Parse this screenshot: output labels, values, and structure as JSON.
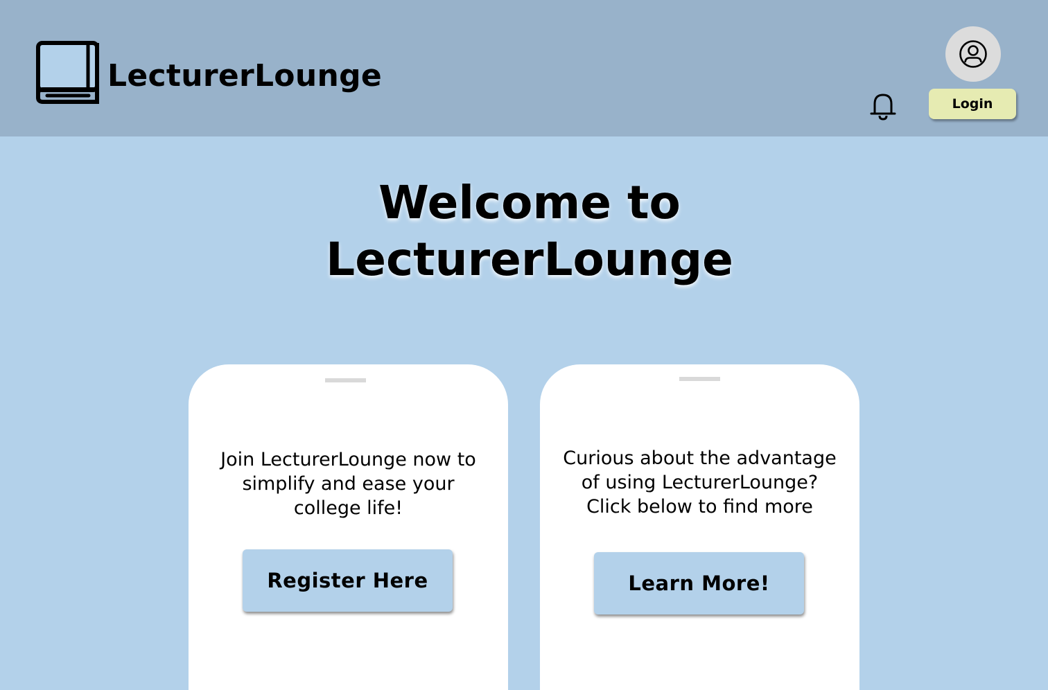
{
  "header": {
    "brand": "LecturerLounge",
    "logo_icon": "book-icon",
    "avatar_icon": "user-circle-icon",
    "notification_icon": "bell-icon",
    "login_label": "Login"
  },
  "hero": {
    "title_line1": "Welcome to",
    "title_line2": "LecturerLounge"
  },
  "cards": [
    {
      "text_line1": "Join LecturerLounge now to",
      "text_line2": "simplify and ease your",
      "text_line3": "college life!",
      "button_label": "Register Here"
    },
    {
      "text_line1": "Curious about the advantage",
      "text_line2": "of using LecturerLounge?",
      "text_line3": "Click below to find more",
      "button_label": "Learn More!"
    }
  ],
  "colors": {
    "header_bg": "#98b2ca",
    "page_bg": "#b3d1ea",
    "login_bg": "#e6ebb2",
    "card_bg": "#ffffff",
    "button_bg": "#b3d1ea"
  }
}
